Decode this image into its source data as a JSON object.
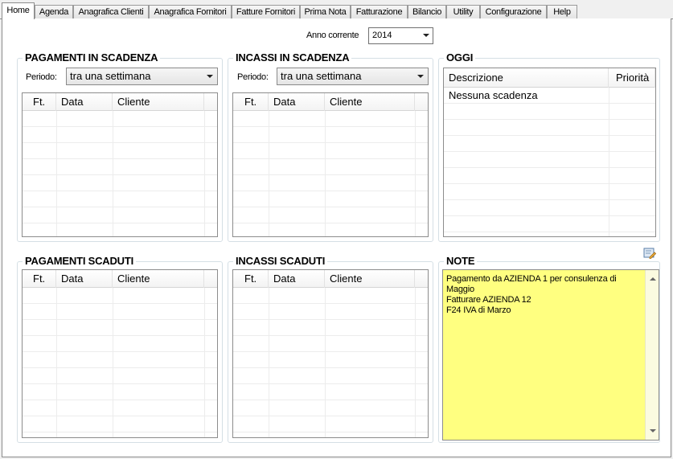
{
  "tabs": [
    "Home",
    "Agenda",
    "Anagrafica Clienti",
    "Anagrafica Fornitori",
    "Fatture Fornitori",
    "Prima Nota",
    "Fatturazione",
    "Bilancio",
    "Utility",
    "Configurazione",
    "Help"
  ],
  "header": {
    "anno_label": "Anno corrente",
    "anno_value": "2014"
  },
  "pagamenti_scadenza": {
    "title": "PAGAMENTI IN SCADENZA",
    "periodo_label": "Periodo:",
    "periodo_value": "tra una settimana",
    "columns": [
      "Ft.",
      "Data",
      "Cliente"
    ]
  },
  "incassi_scadenza": {
    "title": "INCASSI IN SCADENZA",
    "periodo_label": "Periodo:",
    "periodo_value": "tra una settimana",
    "columns": [
      "Ft.",
      "Data",
      "Cliente"
    ]
  },
  "oggi": {
    "title": "OGGI",
    "columns": [
      "Descrizione",
      "Priorità"
    ],
    "rows": [
      "Nessuna scadenza"
    ]
  },
  "pagamenti_scaduti": {
    "title": "PAGAMENTI SCADUTI",
    "columns": [
      "Ft.",
      "Data",
      "Cliente"
    ]
  },
  "incassi_scaduti": {
    "title": "INCASSI SCADUTI",
    "columns": [
      "Ft.",
      "Data",
      "Cliente"
    ]
  },
  "note": {
    "title": "NOTE",
    "lines": [
      "Pagamento da AZIENDA 1 per consulenza di",
      "Maggio",
      "Fatturare AZIENDA 12",
      "F24 IVA di Marzo"
    ]
  },
  "icons": {
    "edit_note": "note-edit-icon"
  }
}
